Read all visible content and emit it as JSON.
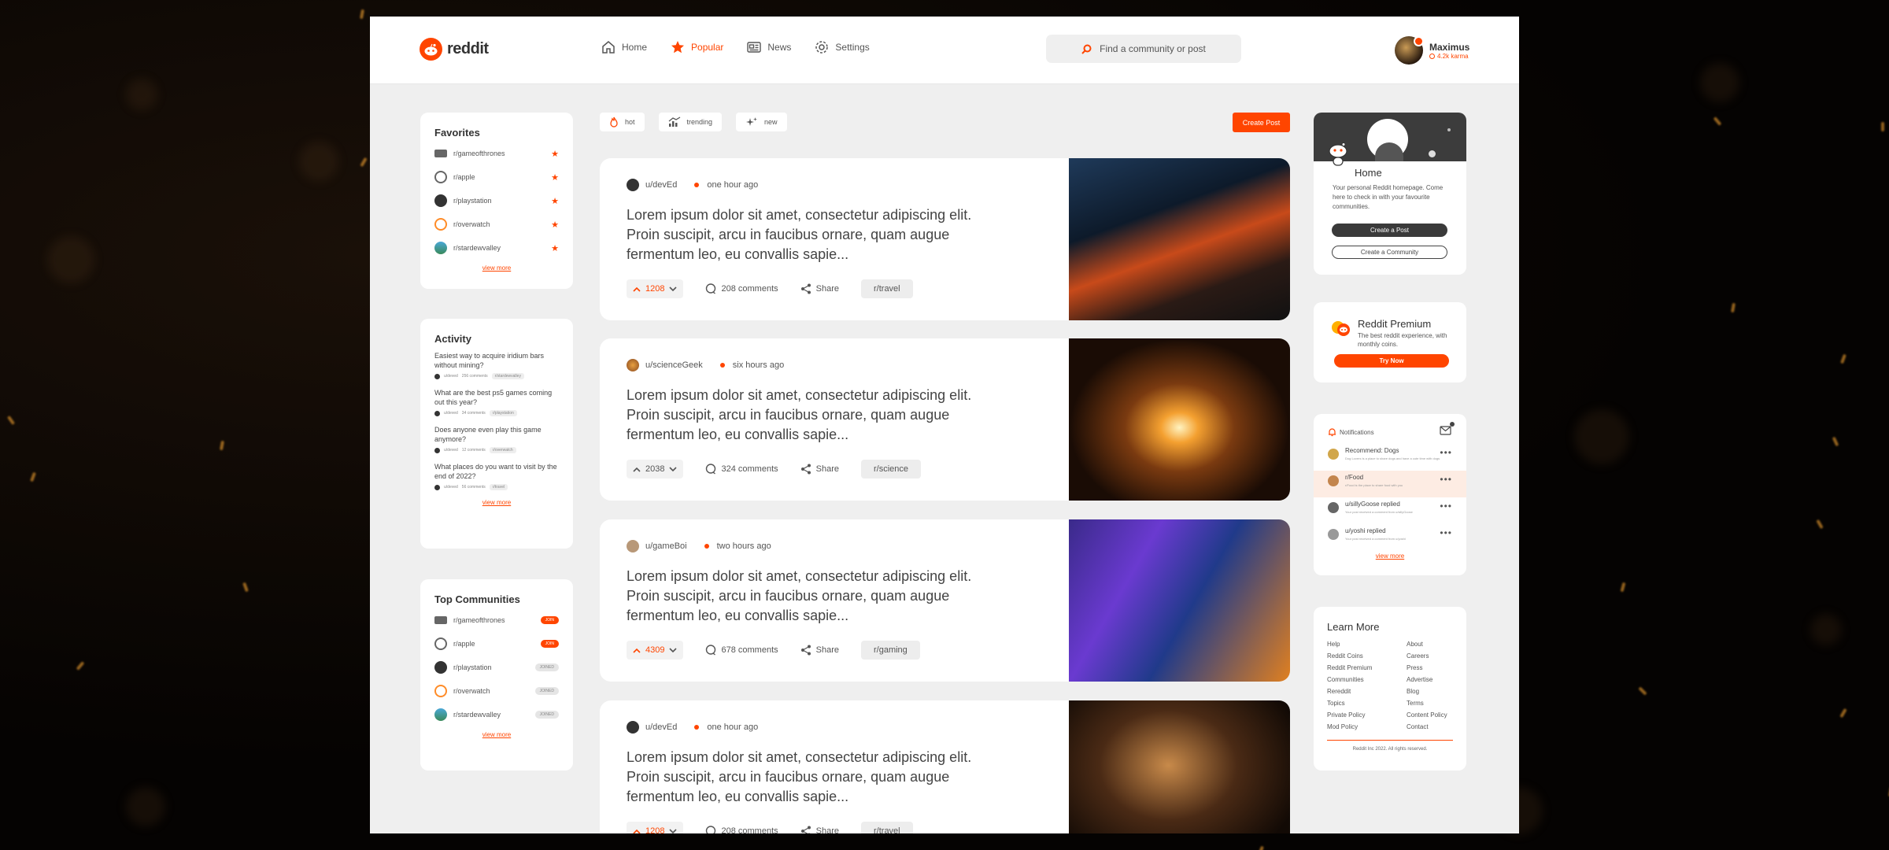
{
  "header": {
    "logo_text": "reddit",
    "nav": [
      {
        "label": "Home",
        "icon": "home-icon",
        "active": false
      },
      {
        "label": "Popular",
        "icon": "star-icon",
        "active": true
      },
      {
        "label": "News",
        "icon": "news-icon",
        "active": false
      },
      {
        "label": "Settings",
        "icon": "settings-icon",
        "active": false
      }
    ],
    "search_placeholder": "Find a community or post",
    "user": {
      "name": "Maximus",
      "karma": "4.2k karma"
    }
  },
  "favorites": {
    "title": "Favorites",
    "items": [
      "r/gameofthrones",
      "r/apple",
      "r/playstation",
      "r/overwatch",
      "r/stardewvalley"
    ],
    "view_more": "view more"
  },
  "activity": {
    "title": "Activity",
    "items": [
      {
        "title": "Easiest way to acquire iridium bars without mining?",
        "user": "u/deved",
        "comments": "256 comments",
        "tag": "r/stardewvalley"
      },
      {
        "title": "What are the best ps5 games coming out this year?",
        "user": "u/deved",
        "comments": "34 comments",
        "tag": "r/playstation"
      },
      {
        "title": "Does anyone even play this game anymore?",
        "user": "u/deved",
        "comments": "12 comments",
        "tag": "r/overwatch"
      },
      {
        "title": "What places do you want to visit by the end of 2022?",
        "user": "u/deved",
        "comments": "56 comments",
        "tag": "r/travel"
      }
    ],
    "view_more": "view more"
  },
  "top_communities": {
    "title": "Top Communities",
    "items": [
      {
        "name": "r/gameofthrones",
        "action": "JOIN",
        "joined": false
      },
      {
        "name": "r/apple",
        "action": "JOIN",
        "joined": false
      },
      {
        "name": "r/playstation",
        "action": "JOINED",
        "joined": true
      },
      {
        "name": "r/overwatch",
        "action": "JOINED",
        "joined": true
      },
      {
        "name": "r/stardewvalley",
        "action": "JOINED",
        "joined": true
      }
    ],
    "view_more": "view more"
  },
  "feed": {
    "tabs": [
      "hot",
      "trending",
      "new"
    ],
    "create_post": "Create Post",
    "posts": [
      {
        "user": "u/devEd",
        "time": "one hour ago",
        "title": "Lorem ipsum dolor sit amet, consectetur adipiscing elit. Proin suscipit, arcu in faucibus ornare, quam augue fermentum leo, eu convallis sapie...",
        "votes": "1208",
        "comments": "208 comments",
        "share": "Share",
        "sub": "r/travel",
        "hot": true
      },
      {
        "user": "u/scienceGeek",
        "time": "six hours ago",
        "title": "Lorem ipsum dolor sit amet, consectetur adipiscing elit. Proin suscipit, arcu in faucibus ornare, quam augue fermentum leo, eu convallis sapie...",
        "votes": "2038",
        "comments": "324 comments",
        "share": "Share",
        "sub": "r/science",
        "hot": false
      },
      {
        "user": "u/gameBoi",
        "time": "two hours ago",
        "title": "Lorem ipsum dolor sit amet, consectetur adipiscing elit. Proin suscipit, arcu in faucibus ornare, quam augue fermentum leo, eu convallis sapie...",
        "votes": "4309",
        "comments": "678 comments",
        "share": "Share",
        "sub": "r/gaming",
        "hot": true
      },
      {
        "user": "u/devEd",
        "time": "one hour ago",
        "title": "Lorem ipsum dolor sit amet, consectetur adipiscing elit. Proin suscipit, arcu in faucibus ornare, quam augue fermentum leo, eu convallis sapie...",
        "votes": "1208",
        "comments": "208 comments",
        "share": "Share",
        "sub": "r/travel",
        "hot": true
      }
    ]
  },
  "home_card": {
    "title": "Home",
    "desc": "Your personal Reddit homepage. Come here to check in with your favourite communities.",
    "btn_post": "Create a Post",
    "btn_community": "Create a Community"
  },
  "premium": {
    "title": "Reddit Premium",
    "desc": "The best reddit experience, with monthly coins.",
    "btn": "Try Now"
  },
  "notifications": {
    "title": "Notifications",
    "items": [
      {
        "title": "Recommend: Dogs",
        "sub": "Dog Lovers is a place to share dogs and have a cute time with dogs",
        "highlight": false
      },
      {
        "title": "r/Food",
        "sub": "r/Food is the place to share food with you",
        "highlight": true
      },
      {
        "title": "u/sillyGoose replied",
        "sub": "Your post received a comment from u/sillyGoose",
        "highlight": false
      },
      {
        "title": "u/yoshi replied",
        "sub": "Your post received a comment from u/yoshi",
        "highlight": false
      }
    ],
    "view_more": "view more"
  },
  "learn_more": {
    "title": "Learn More",
    "left": [
      "Help",
      "Reddit Coins",
      "Reddit Premium",
      "Communities",
      "Rereddit",
      "Topics",
      "Private Policy",
      "Mod Policy"
    ],
    "right": [
      "About",
      "Careers",
      "Press",
      "Advertise",
      "Blog",
      "Terms",
      "Content Policy",
      "Contact"
    ],
    "footer": "Reddit Inc 2022. All rights reserved."
  },
  "colors": {
    "accent": "#ff4500",
    "bg": "#efefef",
    "card": "#ffffff"
  }
}
